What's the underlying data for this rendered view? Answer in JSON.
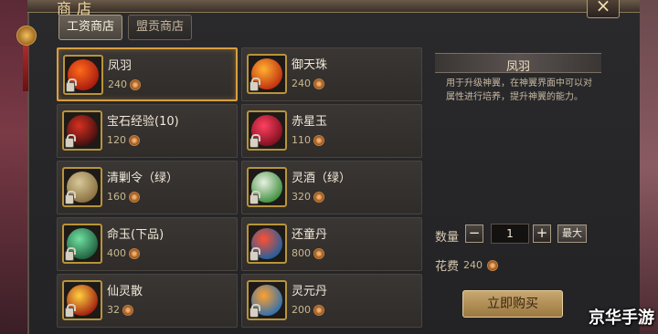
{
  "window": {
    "title": "商店",
    "close_label": "×"
  },
  "tabs": [
    {
      "label": "工资商店",
      "active": true
    },
    {
      "label": "盟贡商店",
      "active": false
    }
  ],
  "items": [
    {
      "name": "凤羽",
      "price": "240",
      "icon": "phoenix-feather-icon",
      "colors": [
        "#ff6a1a",
        "#a81a10"
      ]
    },
    {
      "name": "御天珠",
      "price": "240",
      "icon": "fire-pearl-icon",
      "colors": [
        "#ffb030",
        "#c03010"
      ]
    },
    {
      "name": "宝石经验(10)",
      "price": "120",
      "icon": "gem-exp-icon",
      "colors": [
        "#d83020",
        "#401010"
      ]
    },
    {
      "name": "赤星玉",
      "price": "110",
      "icon": "red-star-jade-icon",
      "colors": [
        "#ff4060",
        "#801020"
      ]
    },
    {
      "name": "清剿令（绿）",
      "price": "160",
      "icon": "scroll-order-icon",
      "colors": [
        "#d8c898",
        "#8a7040"
      ]
    },
    {
      "name": "灵酒（绿）",
      "price": "320",
      "icon": "spirit-wine-icon",
      "colors": [
        "#e8f0e0",
        "#409040"
      ]
    },
    {
      "name": "命玉(下品)",
      "price": "400",
      "icon": "life-jade-icon",
      "colors": [
        "#70e0a0",
        "#206040"
      ]
    },
    {
      "name": "还童丹",
      "price": "800",
      "icon": "youth-pill-icon",
      "colors": [
        "#ff5030",
        "#2060a0"
      ]
    },
    {
      "name": "仙灵散",
      "price": "32",
      "icon": "immortal-powder-icon",
      "colors": [
        "#ffd040",
        "#a02010"
      ]
    },
    {
      "name": "灵元丹",
      "price": "200",
      "icon": "spirit-pill-icon",
      "colors": [
        "#ffa030",
        "#3070b0"
      ]
    }
  ],
  "detail": {
    "title": "凤羽",
    "description": "用于升级神翼，在神翼界面中可以对属性进行培养，提升神翼的能力。",
    "qty_label": "数量",
    "minus_label": "−",
    "qty_value": "1",
    "plus_label": "+",
    "max_label": "最大",
    "cost_label": "花费",
    "cost_value": "240",
    "buy_label": "立即购买"
  },
  "watermark": "京华手游"
}
